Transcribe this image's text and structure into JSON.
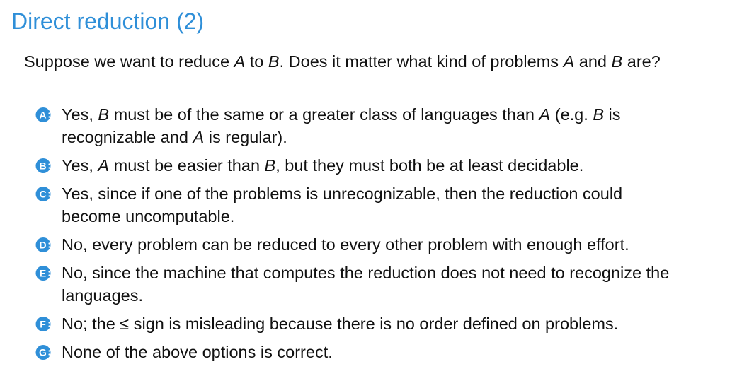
{
  "title": "Direct reduction (2)",
  "question": {
    "p1": "Suppose we want to reduce ",
    "a": "A",
    "p2": " to ",
    "b": "B",
    "p3": ". Does it matter what kind of problems ",
    "a2": "A",
    "p4": " and ",
    "b2": "B",
    "p5": " are?"
  },
  "options": [
    {
      "letter": "A",
      "s1": "Yes, ",
      "v1": "B",
      "s2": " must be of the same or a greater class of languages than ",
      "v2": "A",
      "s3": " (e.g. ",
      "v3": "B",
      "s4": " is",
      "s5": "recognizable and ",
      "v4": "A",
      "s6": " is regular)."
    },
    {
      "letter": "B",
      "s1": "Yes, ",
      "v1": "A",
      "s2": " must be easier than ",
      "v2": "B",
      "s3": ", but they must both be at least decidable."
    },
    {
      "letter": "C",
      "s1": "Yes, since if one of the problems is unrecognizable, then the reduction could",
      "s2": "become uncomputable."
    },
    {
      "letter": "D",
      "s1": "No, every problem can be reduced to every other problem with enough effort."
    },
    {
      "letter": "E",
      "s1": "No, since the machine that computes the reduction does not need to recognize the",
      "s2": "languages."
    },
    {
      "letter": "F",
      "s1": "No; the ",
      "sym": "≤",
      "s2": " sign is misleading because there is no order defined on problems."
    },
    {
      "letter": "G",
      "s1": "None of the above options is correct."
    }
  ],
  "colors": {
    "accent": "#2f8fd8",
    "text": "#111111"
  }
}
